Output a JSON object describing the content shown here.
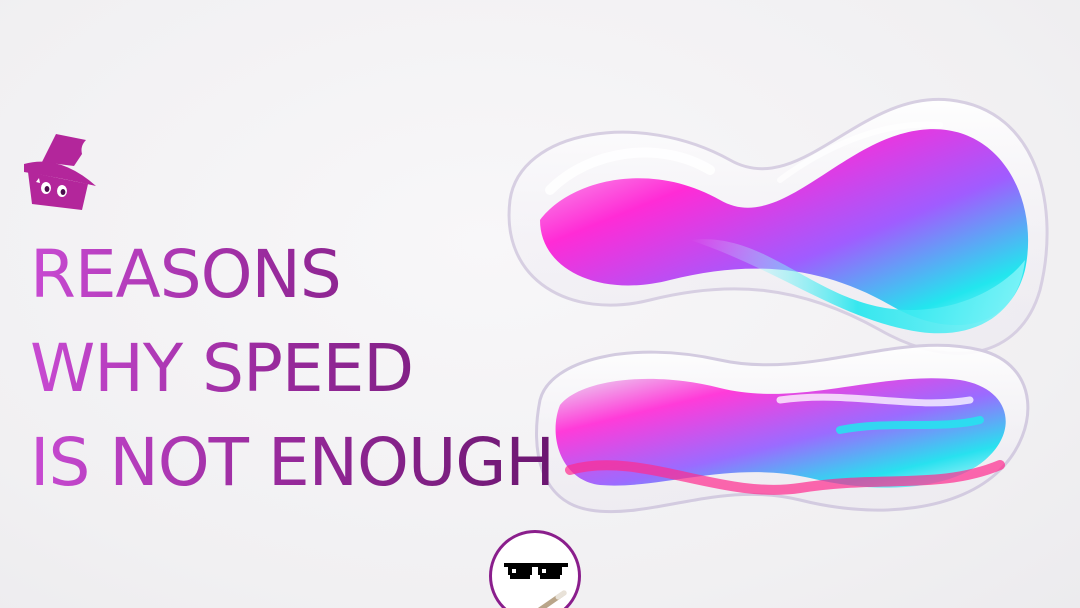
{
  "headline": {
    "line1": "REASONS",
    "line2": "WHY SPEED",
    "line3": "IS NOT ENOUGH"
  },
  "brand": {
    "logo_icon": "wizard-hat-icon",
    "accent": "#b3269b",
    "text_gradient": [
      "#c84ad2",
      "#9a2b9e",
      "#6b1670"
    ]
  },
  "decoration": {
    "art": "glass-wave-ribbon",
    "colors": [
      "#ff2bd6",
      "#a05cff",
      "#22e6ee"
    ]
  },
  "avatar": {
    "icon": "pixel-sunglasses-icon",
    "border_color": "#8a1e8c"
  }
}
